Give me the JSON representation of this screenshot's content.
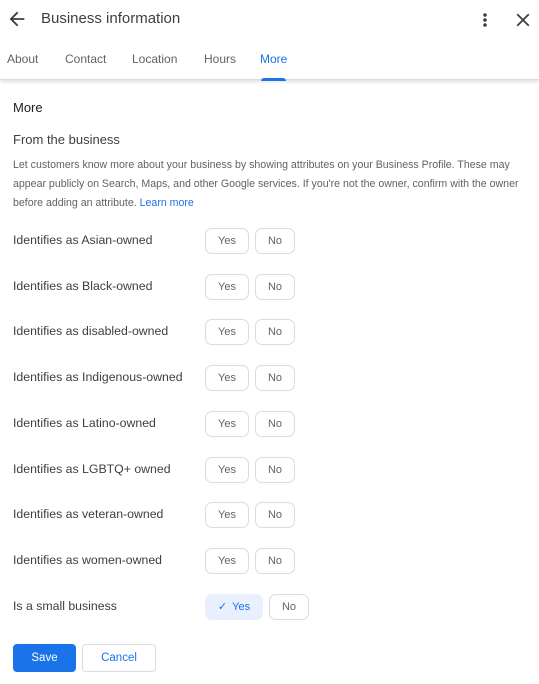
{
  "header": {
    "title": "Business information",
    "back_icon": "arrow-left-icon",
    "more_icon": "more-vert-icon",
    "close_icon": "close-icon"
  },
  "tabs": [
    {
      "label": "About",
      "active": false
    },
    {
      "label": "Contact",
      "active": false
    },
    {
      "label": "Location",
      "active": false
    },
    {
      "label": "Hours",
      "active": false
    },
    {
      "label": "More",
      "active": true
    }
  ],
  "section": {
    "title": "More",
    "subtitle": "From the business",
    "description": "Let customers know more about your business by showing attributes on your Business Profile. These may appear publicly on Search, Maps, and other Google services. If you're not the owner, confirm with the owner before adding an attribute.",
    "learn_more": "Learn more"
  },
  "attributes": [
    {
      "label": "Identifies as Asian-owned",
      "yes": "Yes",
      "no": "No",
      "value": null
    },
    {
      "label": "Identifies as Black-owned",
      "yes": "Yes",
      "no": "No",
      "value": null
    },
    {
      "label": "Identifies as disabled-owned",
      "yes": "Yes",
      "no": "No",
      "value": null
    },
    {
      "label": "Identifies as Indigenous-owned",
      "yes": "Yes",
      "no": "No",
      "value": null
    },
    {
      "label": "Identifies as Latino-owned",
      "yes": "Yes",
      "no": "No",
      "value": null
    },
    {
      "label": "Identifies as LGBTQ+ owned",
      "yes": "Yes",
      "no": "No",
      "value": null
    },
    {
      "label": "Identifies as veteran-owned",
      "yes": "Yes",
      "no": "No",
      "value": null
    },
    {
      "label": "Identifies as women-owned",
      "yes": "Yes",
      "no": "No",
      "value": null
    },
    {
      "label": "Is a small business",
      "yes": "Yes",
      "no": "No",
      "value": "Yes"
    }
  ],
  "actions": {
    "save": "Save",
    "cancel": "Cancel"
  },
  "colors": {
    "accent": "#1a73e8",
    "selected_bg": "#e8f0fe"
  }
}
